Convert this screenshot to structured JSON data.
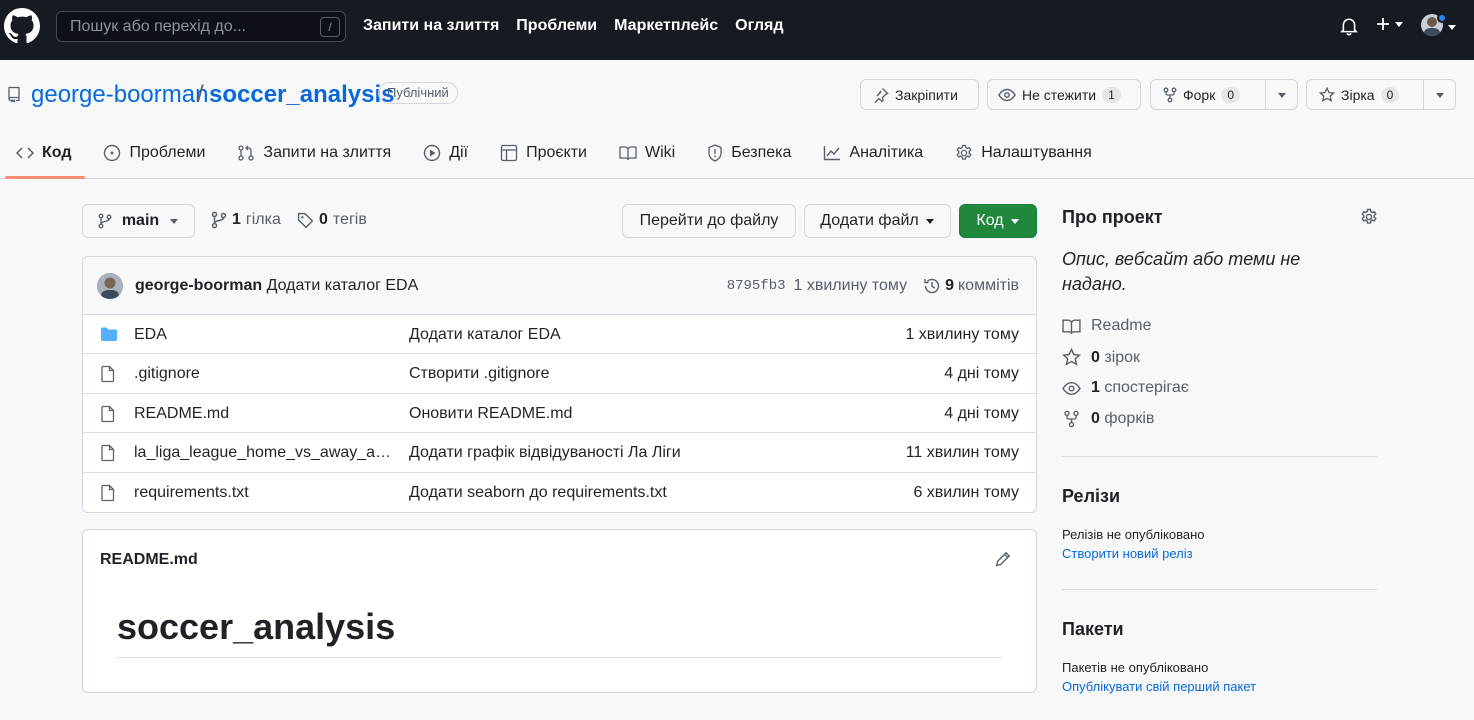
{
  "topbar": {
    "search_placeholder": "Пошук або перехід до...",
    "search_shortcut": "/",
    "nav": [
      "Запити на злиття",
      "Проблеми",
      "Маркетплейс",
      "Огляд"
    ]
  },
  "repo": {
    "owner": "george-boorman",
    "separator": "/",
    "name": "soccer_analysis",
    "visibility": "Публічний",
    "pin_label": "Закріпити",
    "watch_label": "Не стежити",
    "watch_count": "1",
    "fork_label": "Форк",
    "fork_count": "0",
    "star_label": "Зірка",
    "star_count": "0"
  },
  "tabs": [
    {
      "label": "Код",
      "icon": "code-icon"
    },
    {
      "label": "Проблеми",
      "icon": "issue-icon"
    },
    {
      "label": "Запити на злиття",
      "icon": "pull-request-icon"
    },
    {
      "label": "Дії",
      "icon": "play-icon"
    },
    {
      "label": "Проєкти",
      "icon": "table-icon"
    },
    {
      "label": "Wiki",
      "icon": "book-icon"
    },
    {
      "label": "Безпека",
      "icon": "shield-icon"
    },
    {
      "label": "Аналітика",
      "icon": "graph-icon"
    },
    {
      "label": "Налаштування",
      "icon": "gear-icon"
    }
  ],
  "toolbar": {
    "branch": "main",
    "branches_count": "1",
    "branches_label": "гілка",
    "tags_count": "0",
    "tags_label": "тегів",
    "goto_file": "Перейти до файлу",
    "add_file": "Додати файл",
    "code": "Код"
  },
  "commit": {
    "author": "george-boorman",
    "message": "Додати каталог EDA",
    "sha": "8795fb3",
    "time": "1 хвилину тому",
    "commits_count": "9",
    "commits_label": "коммітів"
  },
  "files": [
    {
      "type": "folder",
      "name": "EDA",
      "message": "Додати каталог EDA",
      "time": "1 хвилину тому"
    },
    {
      "type": "file",
      "name": ".gitignore",
      "message": "Створити .gitignore",
      "time": "4 дні тому"
    },
    {
      "type": "file",
      "name": "README.md",
      "message": "Оновити README.md",
      "time": "4 дні тому"
    },
    {
      "type": "file",
      "name": "la_liga_league_home_vs_away_att...",
      "message": "Додати графік відвідуваності Ла Ліги",
      "time": "11 хвилин тому"
    },
    {
      "type": "file",
      "name": "requirements.txt",
      "message": "Додати seaborn до requirements.txt",
      "time": "6 хвилин тому"
    }
  ],
  "readme": {
    "filename": "README.md",
    "heading": "soccer_analysis"
  },
  "about": {
    "title": "Про проект",
    "description": "Опис, вебсайт або теми не надано.",
    "readme": "Readme",
    "stars_count": "0",
    "stars_label": "зірок",
    "watchers_count": "1",
    "watchers_label": "спостерігає",
    "forks_count": "0",
    "forks_label": "форків"
  },
  "releases": {
    "title": "Релізи",
    "empty": "Релізів не опубліковано",
    "create_link": "Створити новий реліз"
  },
  "packages": {
    "title": "Пакети",
    "empty": "Пакетів не опубліковано",
    "publish_link": "Опублікувати свій перший пакет"
  },
  "colors": {
    "header_bg": "#161b22",
    "accent_link": "#0969da",
    "primary_button": "#1f883d",
    "tab_underline": "#fd8c73"
  }
}
